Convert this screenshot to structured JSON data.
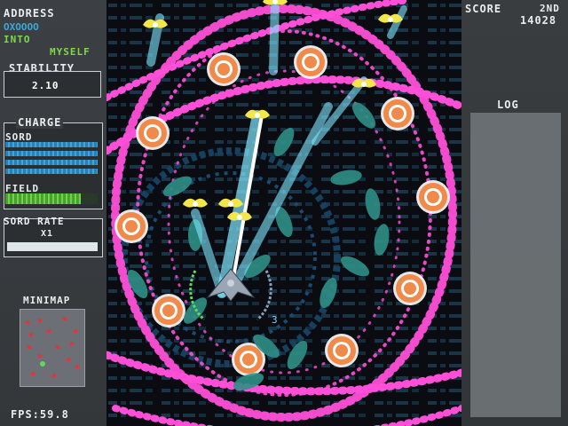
{
  "hud_left": {
    "address_label": "ADDRESS",
    "address_code": "OXOOOO",
    "into_label": "INTO",
    "myself_label": "MYSELF",
    "stability_label": "STABILITY",
    "stability_value": "2.10",
    "charge_label": "CHARGE",
    "sord_label": "SORD",
    "field_label": "FIELD",
    "sord_rate_label": "SORD RATE",
    "sord_rate_value": "X1",
    "minimap_label": "MINIMAP",
    "fps_text": "FPS:59.8"
  },
  "hud_right": {
    "score_label": "SCORE",
    "rank_label": "2ND",
    "score_value": "14028",
    "log_label": "LOG"
  },
  "player": {
    "lock_count": "3"
  },
  "colors": {
    "cyan_accent": "#3fa6d6",
    "green_field": "#5fbf3a",
    "pink_bullet": "#ff4fd8",
    "orange_target": "#f08a4a",
    "teal_leaf": "#2f8f86"
  },
  "meters": {
    "sord_fill": 1.0,
    "field_fill": 0.82,
    "sord_rate_fill": 1.0
  },
  "minimap_enemy_count": 14
}
